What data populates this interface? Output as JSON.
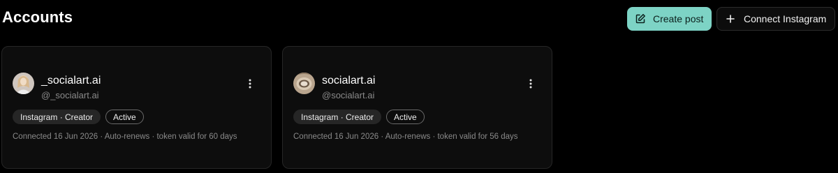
{
  "header": {
    "title": "Accounts",
    "create_post_label": "Create post",
    "connect_label": "Connect Instagram"
  },
  "colors": {
    "accent": "#7dd3c5",
    "background": "#000000",
    "card": "#0d0d0d"
  },
  "accounts": [
    {
      "name": "_socialart.ai",
      "handle": "@_socialart.ai",
      "type_badge": "Instagram · Creator",
      "status_badge": "Active",
      "meta": "Connected 16 Jun 2026 · Auto-renews · token valid for 60 days",
      "avatar_icon": "avatar-photo"
    },
    {
      "name": "socialart.ai",
      "handle": "@socialart.ai",
      "type_badge": "Instagram · Creator",
      "status_badge": "Active",
      "meta": "Connected 16 Jun 2026 · Auto-renews · token valid for 56 days",
      "avatar_icon": "avatar-photo"
    }
  ]
}
